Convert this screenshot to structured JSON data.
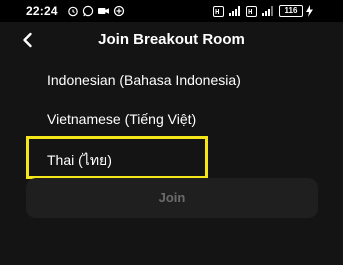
{
  "status_bar": {
    "time": "22:24",
    "battery": "116"
  },
  "header": {
    "title": "Join Breakout Room"
  },
  "languages": [
    "Indonesian (Bahasa Indonesia)",
    "Vietnamese (Tiếng Việt)",
    "Thai (ไทย)"
  ],
  "selected_language_index": 2,
  "join_button": {
    "label": "Join",
    "enabled": false
  },
  "colors": {
    "background": "#141414",
    "highlight": "#f5e61a",
    "disabled_text": "#6b6b6b"
  }
}
